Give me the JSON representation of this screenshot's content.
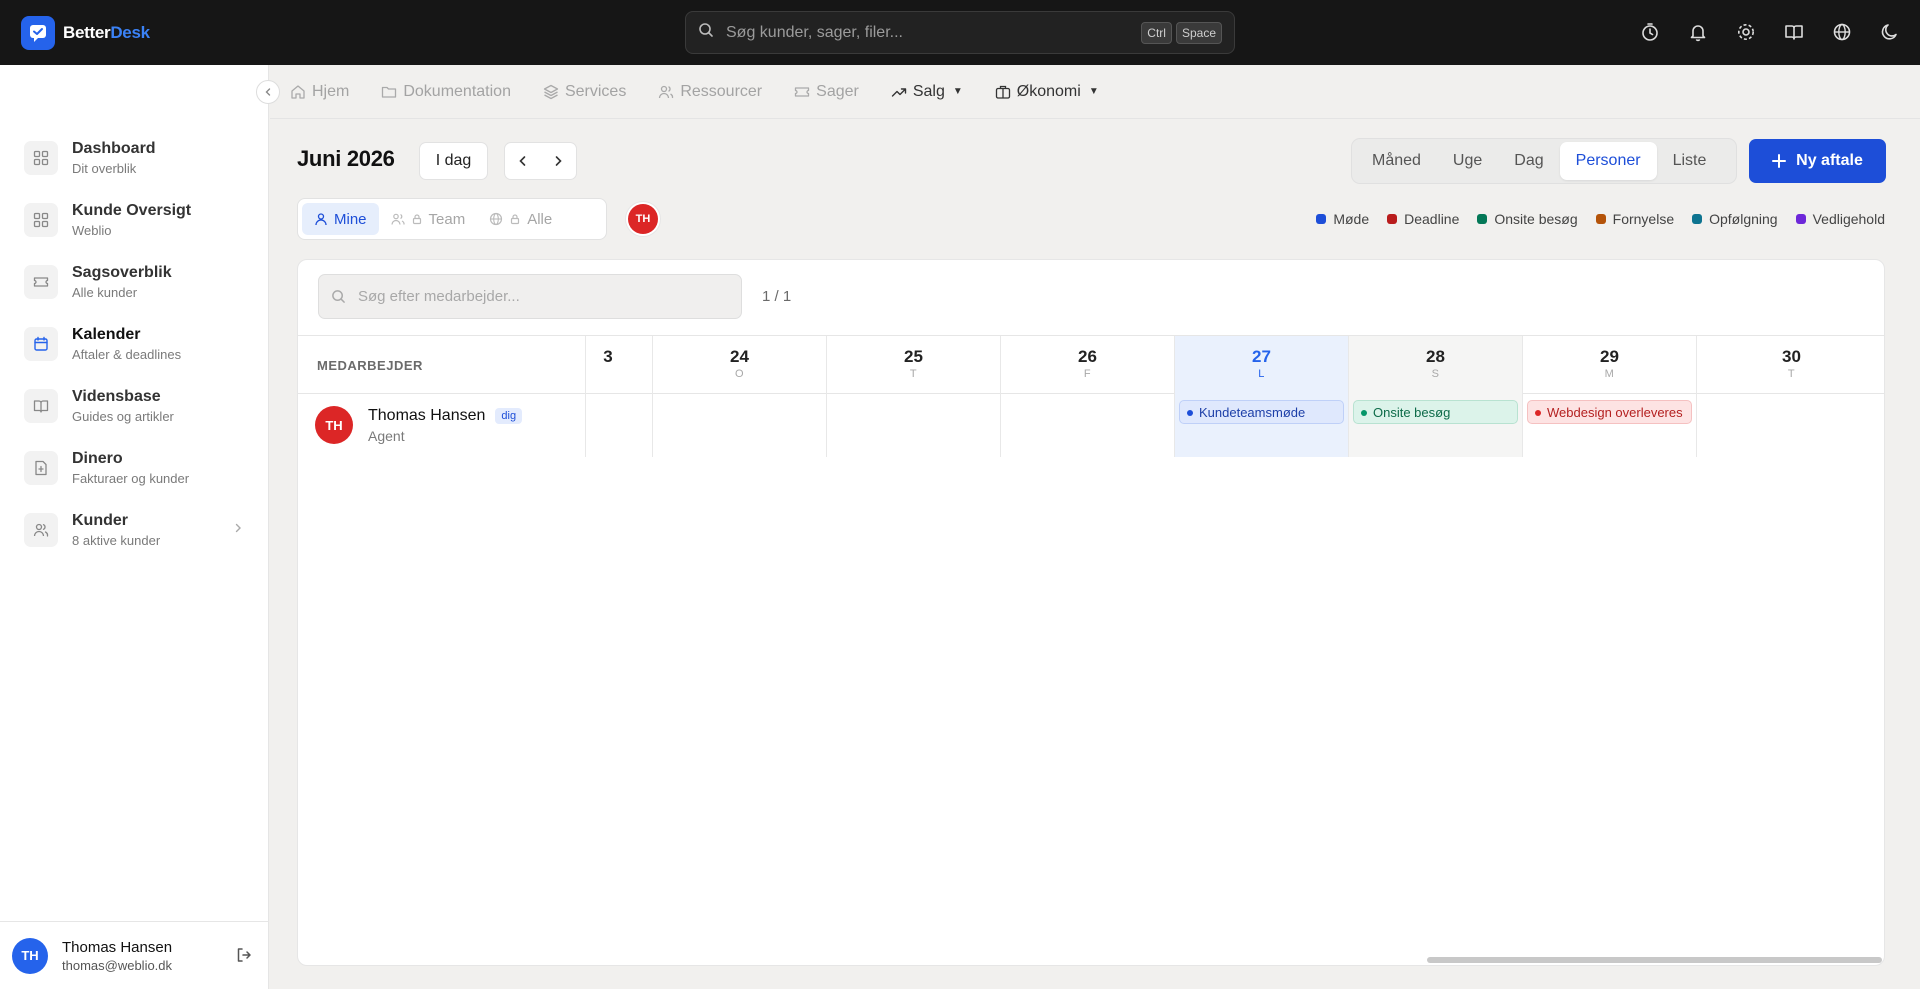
{
  "app": {
    "logo_part1": "Better",
    "logo_part2": "Desk",
    "search_placeholder": "Søg kunder, sager, filer...",
    "kbd_ctrl": "Ctrl",
    "kbd_space": "Space",
    "top_icons": [
      "timer-icon",
      "bell-icon",
      "settings-icon",
      "book-icon",
      "globe-icon",
      "moon-icon"
    ]
  },
  "sidebar": {
    "items": [
      {
        "title": "Dashboard",
        "subtitle": "Dit overblik",
        "icon": "dashboard-icon"
      },
      {
        "title": "Kunde Oversigt",
        "subtitle": "Weblio",
        "icon": "dashboard-icon"
      },
      {
        "title": "Sagsoverblik",
        "subtitle": "Alle kunder",
        "icon": "ticket-icon"
      },
      {
        "title": "Kalender",
        "subtitle": "Aftaler & deadlines",
        "icon": "calendar-icon"
      },
      {
        "title": "Vidensbase",
        "subtitle": "Guides og artikler",
        "icon": "book-icon"
      },
      {
        "title": "Dinero",
        "subtitle": "Fakturaer og kunder",
        "icon": "invoice-icon"
      },
      {
        "title": "Kunder",
        "subtitle": "8 aktive kunder",
        "icon": "users-icon"
      }
    ],
    "user": {
      "initials": "TH",
      "name": "Thomas Hansen",
      "email": "thomas@weblio.dk"
    }
  },
  "subnav": {
    "items": [
      "Hjem",
      "Dokumentation",
      "Services",
      "Ressourcer",
      "Sager",
      "Salg",
      "Økonomi"
    ]
  },
  "toolbar": {
    "month": "Juni 2026",
    "today": "I dag",
    "views": [
      "Måned",
      "Uge",
      "Dag",
      "Personer",
      "Liste"
    ],
    "active_view": "Personer",
    "new_button": "Ny aftale",
    "scopes": [
      "Mine",
      "Team",
      "Alle"
    ],
    "scope_avatar": "TH"
  },
  "legend": [
    {
      "label": "Møde",
      "color": "#1d4ed8"
    },
    {
      "label": "Deadline",
      "color": "#b91c1c"
    },
    {
      "label": "Onsite besøg",
      "color": "#047857"
    },
    {
      "label": "Fornyelse",
      "color": "#b45309"
    },
    {
      "label": "Opfølgning",
      "color": "#0e7490"
    },
    {
      "label": "Vedligehold",
      "color": "#6d28d9"
    }
  ],
  "panel": {
    "search_placeholder": "Søg efter medarbejder...",
    "count": "1 / 1",
    "column_label": "MEDARBEJDER",
    "partial_day": "3",
    "days": [
      {
        "num": "24",
        "dow": "O"
      },
      {
        "num": "25",
        "dow": "T"
      },
      {
        "num": "26",
        "dow": "F"
      },
      {
        "num": "27",
        "dow": "L"
      },
      {
        "num": "28",
        "dow": "S"
      },
      {
        "num": "29",
        "dow": "M"
      },
      {
        "num": "30",
        "dow": "T"
      }
    ],
    "person": {
      "initials": "TH",
      "name": "Thomas Hansen",
      "badge": "dig",
      "role": "Agent"
    },
    "events": [
      {
        "label": "Kundeteamsmøde"
      },
      {
        "label": "Onsite besøg"
      },
      {
        "label": "Webdesign overleveres"
      }
    ]
  }
}
